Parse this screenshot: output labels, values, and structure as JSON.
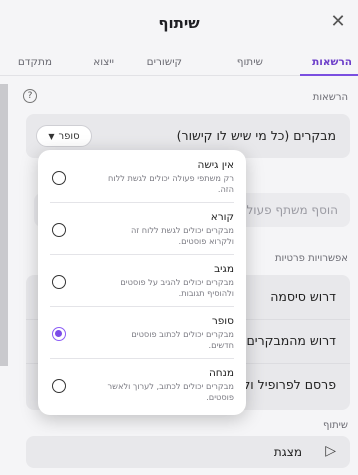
{
  "header": {
    "title": "שיתוף",
    "close_glyph": "✕"
  },
  "tabs": [
    {
      "label": "הרשאות",
      "active": true
    },
    {
      "label": "שיתוף",
      "active": false
    },
    {
      "label": "קישורים",
      "active": false
    },
    {
      "label": "ייצוא",
      "active": false
    },
    {
      "label": "מתקדם",
      "active": false
    }
  ],
  "permissions": {
    "section_label": "הרשאות",
    "help_glyph": "?",
    "visitors_label": "מבקרים (כל מי שיש לו קישור)",
    "role_value": "סופר",
    "add_placeholder": "הוסף משתף פעולה"
  },
  "privacy": {
    "section_label": "אפשרויות פרטיות",
    "rows": [
      "דרוש סיסמה",
      "דרוש מהמבקרים להיות",
      "פרסם לפרופיל ולאינטר"
    ]
  },
  "sharing": {
    "section_label": "שיתוף",
    "present_label": "מצגת",
    "present_icon": "play-outline-icon"
  },
  "dropdown": {
    "items": [
      {
        "title": "אין גישה",
        "desc": "רק משתפי פעולה יכולים לגשת ללוח הזה.",
        "selected": false
      },
      {
        "title": "קורא",
        "desc": "מבקרים יכולים לגשת ללוח זה ולקרוא פוסטים.",
        "selected": false
      },
      {
        "title": "מגיב",
        "desc": "מבקרים יכולים להגיב על פוסטים ולהוסיף תגובות.",
        "selected": false
      },
      {
        "title": "סופר",
        "desc": "מבקרים יכולים לכתוב פוסטים חדשים.",
        "selected": true
      },
      {
        "title": "מנחה",
        "desc": "מבקרים יכולים לכתוב, לערוך ולאשר פוסטים.",
        "selected": false
      }
    ]
  },
  "colors": {
    "accent": "#7c4ce8",
    "panel": "#f5f5f7",
    "card": "#e8e8eb"
  }
}
